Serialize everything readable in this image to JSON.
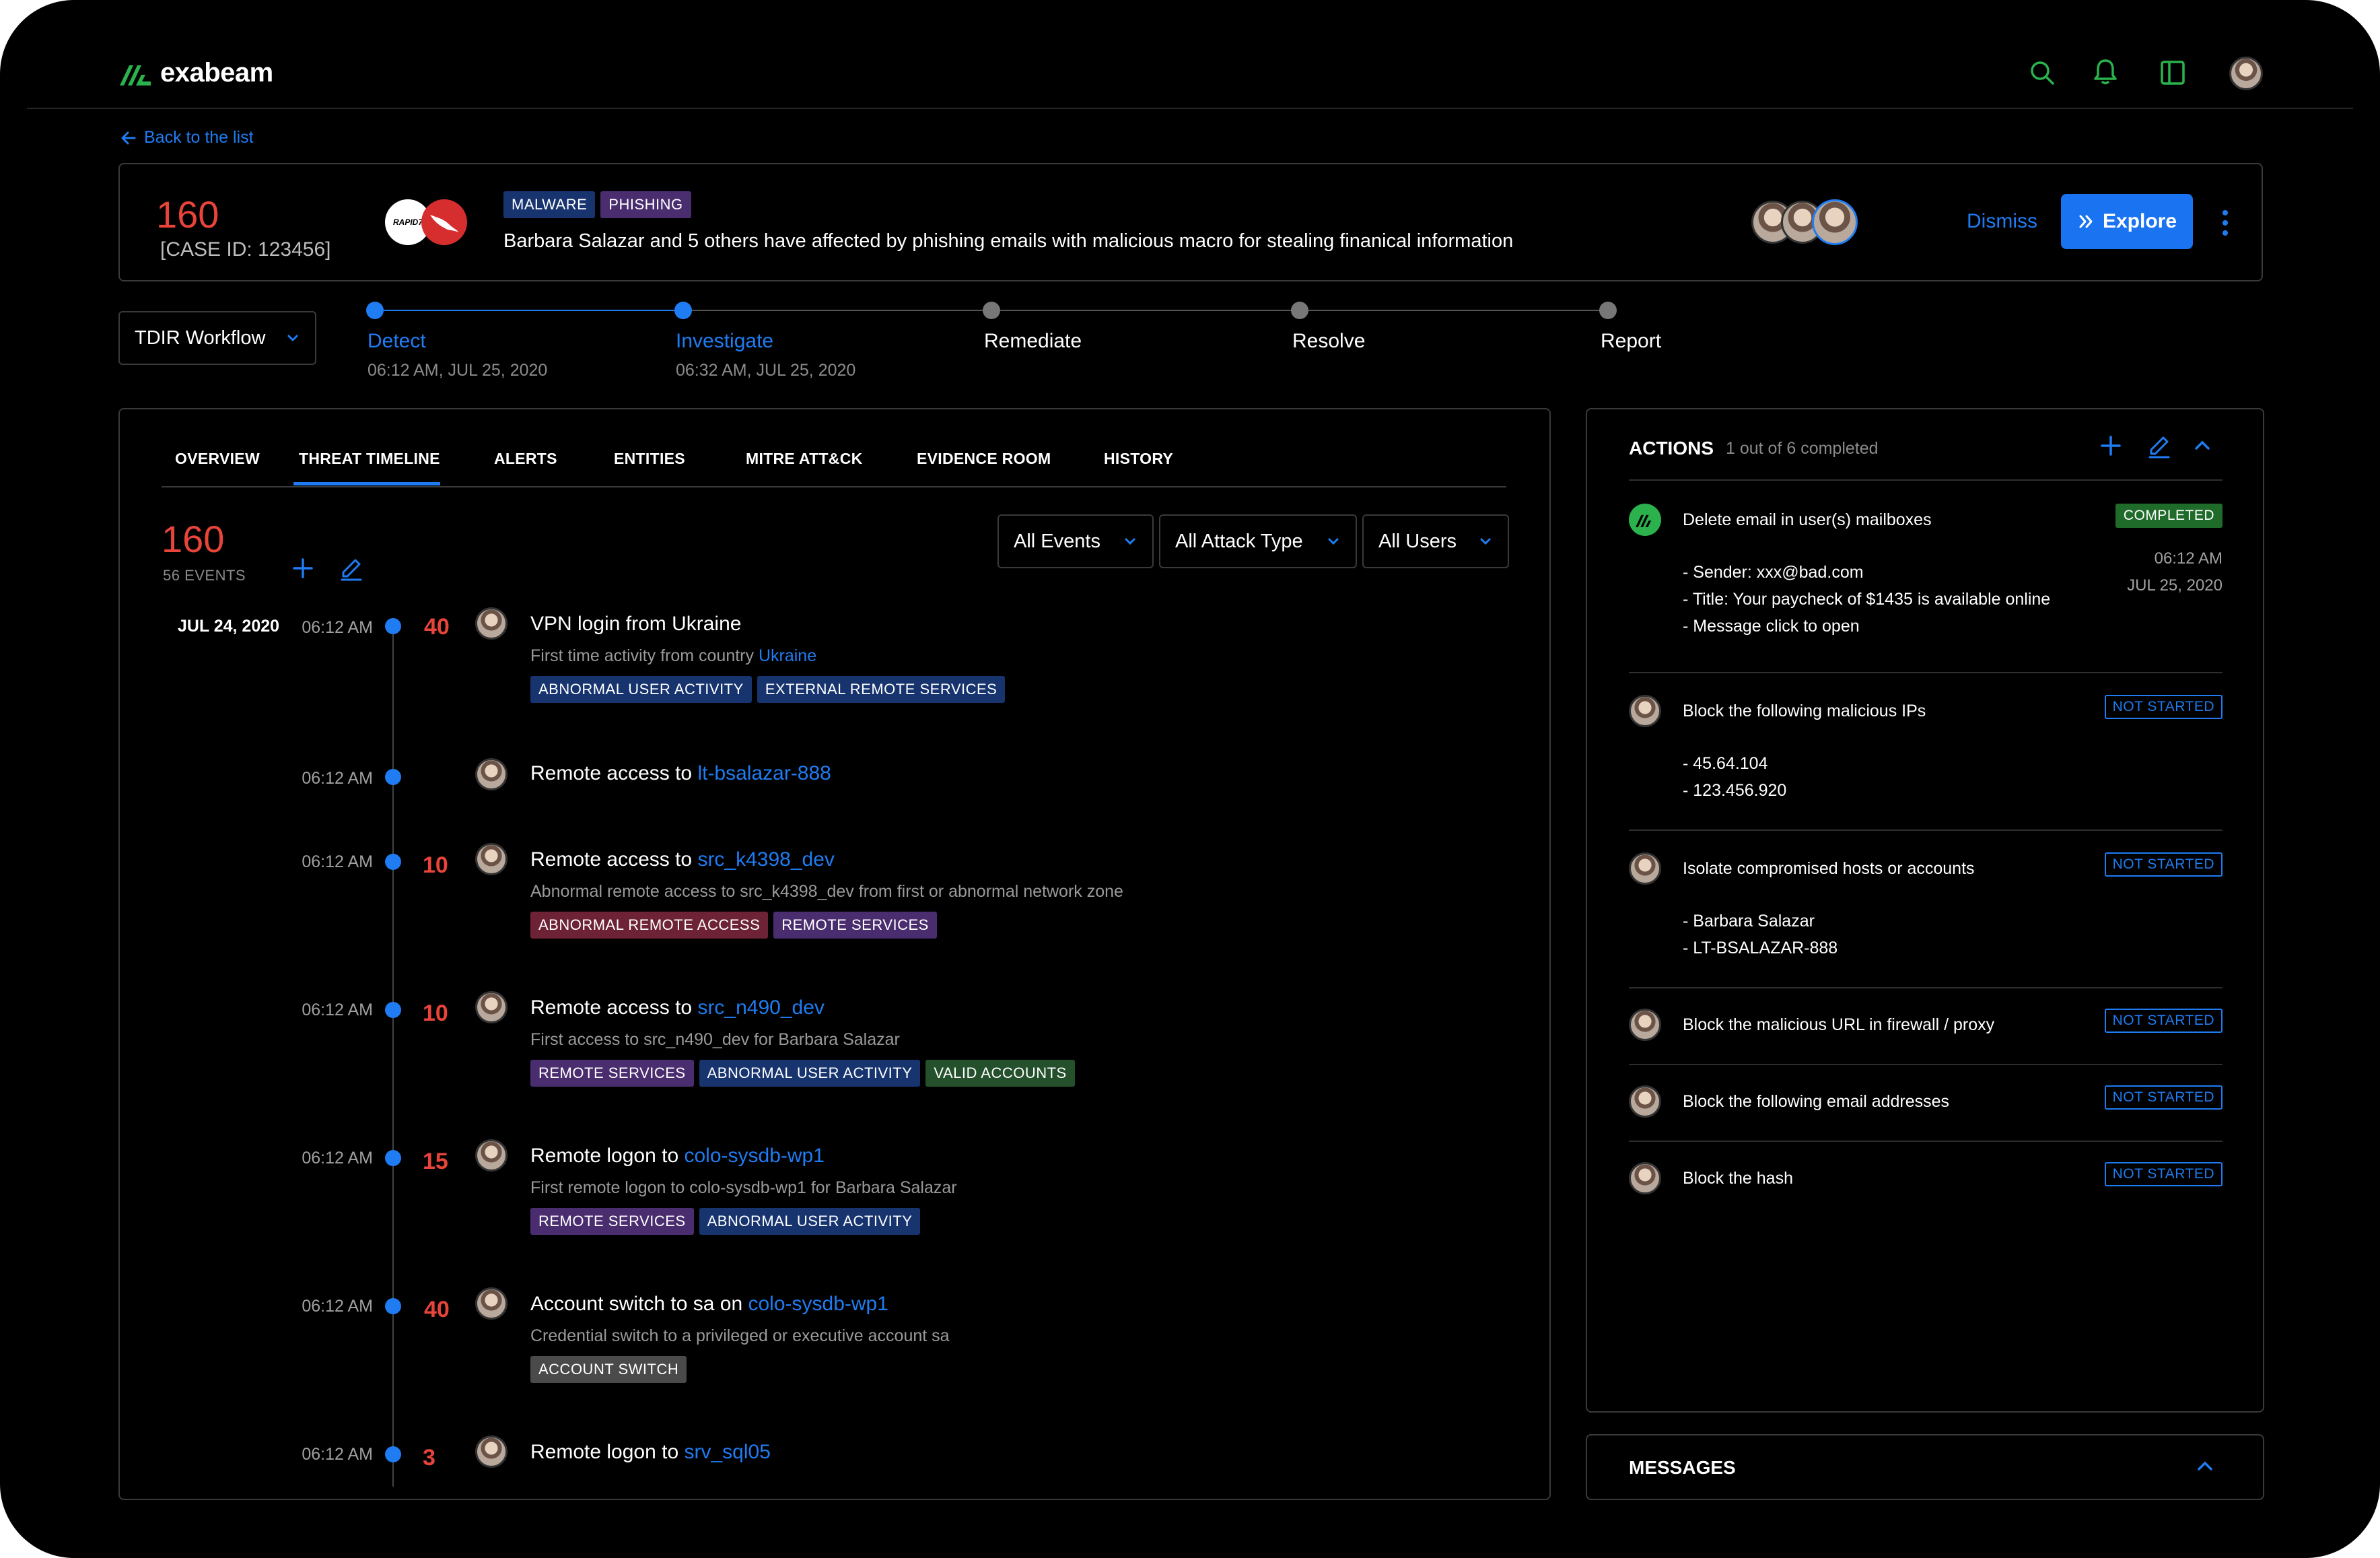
{
  "app": {
    "logo_text": "exabeam",
    "brand_color": "#2bb24c",
    "accent_color": "#1f7cf2"
  },
  "header_icons": [
    "search-icon",
    "bell-icon",
    "panel-icon",
    "user-avatar"
  ],
  "back_link": "Back to the list",
  "case": {
    "score": "160",
    "case_id": "[CASE ID: 123456]",
    "vendor_logo": "RAPID7",
    "tags": [
      "MALWARE",
      "PHISHING"
    ],
    "title": "Barbara Salazar and 5 others have affected by phishing emails with malicious macro for stealing finanical information",
    "dismiss": "Dismiss",
    "explore": "Explore"
  },
  "workflow": {
    "label": "TDIR Workflow"
  },
  "steps": [
    {
      "label": "Detect",
      "time": "06:12 AM, JUL 25, 2020",
      "state": "done"
    },
    {
      "label": "Investigate",
      "time": "06:32 AM, JUL 25, 2020",
      "state": "active"
    },
    {
      "label": "Remediate",
      "time": "",
      "state": "pending"
    },
    {
      "label": "Resolve",
      "time": "",
      "state": "pending"
    },
    {
      "label": "Report",
      "time": "",
      "state": "pending"
    }
  ],
  "tabs": [
    "OVERVIEW",
    "THREAT TIMELINE",
    "ALERTS",
    "ENTITIES",
    "MITRE ATT&CK",
    "EVIDENCE ROOM",
    "HISTORY"
  ],
  "active_tab": "THREAT TIMELINE",
  "timeline": {
    "score": "160",
    "events_count": "56 EVENTS",
    "filters": [
      "All Events",
      "All Attack Type",
      "All Users"
    ],
    "date": "JUL 24, 2020",
    "events": [
      {
        "time": "06:12 AM",
        "score": "40",
        "title": "VPN login from Ukraine",
        "link": "",
        "desc": "First time activity from country ",
        "desc_link": "Ukraine",
        "tags": [
          {
            "t": "ABNORMAL USER ACTIVITY",
            "c": "blue"
          },
          {
            "t": "EXTERNAL REMOTE SERVICES",
            "c": "blue"
          }
        ]
      },
      {
        "time": "06:12 AM",
        "score": "",
        "title": "Remote access to ",
        "link": "lt-bsalazar-888",
        "desc": "",
        "desc_link": "",
        "tags": []
      },
      {
        "time": "06:12 AM",
        "score": "10",
        "title": "Remote access to ",
        "link": "src_k4398_dev",
        "desc": "Abnormal remote access to src_k4398_dev from first or abnormal network zone",
        "desc_link": "",
        "tags": [
          {
            "t": "ABNORMAL REMOTE ACCESS",
            "c": "red"
          },
          {
            "t": "REMOTE SERVICES",
            "c": "purple"
          }
        ]
      },
      {
        "time": "06:12 AM",
        "score": "10",
        "title": "Remote access to ",
        "link": "src_n490_dev",
        "desc": "First access to src_n490_dev for Barbara Salazar",
        "desc_link": "",
        "tags": [
          {
            "t": "REMOTE SERVICES",
            "c": "purple"
          },
          {
            "t": "ABNORMAL USER ACTIVITY",
            "c": "blue"
          },
          {
            "t": "VALID ACCOUNTS",
            "c": "green"
          }
        ]
      },
      {
        "time": "06:12 AM",
        "score": "15",
        "title": "Remote logon to ",
        "link": "colo-sysdb-wp1",
        "desc": "First remote logon to colo-sysdb-wp1 for Barbara Salazar",
        "desc_link": "",
        "tags": [
          {
            "t": "REMOTE SERVICES",
            "c": "purple"
          },
          {
            "t": "ABNORMAL USER ACTIVITY",
            "c": "blue"
          }
        ]
      },
      {
        "time": "06:12 AM",
        "score": "40",
        "title": "Account switch to sa on ",
        "link": "colo-sysdb-wp1",
        "desc": "Credential switch to a privileged or executive account sa",
        "desc_link": "",
        "tags": [
          {
            "t": "ACCOUNT SWITCH",
            "c": "gray"
          }
        ]
      },
      {
        "time": "06:12 AM",
        "score": "3",
        "title": "Remote logon to ",
        "link": "srv_sql05",
        "desc": "",
        "desc_link": "",
        "tags": []
      }
    ]
  },
  "actions": {
    "title": "ACTIONS",
    "progress": "1 out of 6 completed",
    "items": [
      {
        "text": "Delete email in user(s) mailboxes",
        "status": "COMPLETED",
        "time": "06:12 AM",
        "date": "JUL 25, 2020",
        "details": [
          "- Sender: xxx@bad.com",
          "- Title: Your paycheck of $1435 is available online",
          "- Message click to open"
        ]
      },
      {
        "text": "Block the following malicious IPs",
        "status": "NOT STARTED",
        "details": [
          "- 45.64.104",
          "- 123.456.920"
        ]
      },
      {
        "text": "Isolate compromised hosts or accounts",
        "status": "NOT STARTED",
        "details": [
          "- Barbara Salazar",
          "- LT-BSALAZAR-888"
        ]
      },
      {
        "text": "Block the malicious URL in firewall / proxy",
        "status": "NOT STARTED",
        "details": []
      },
      {
        "text": "Block the following email addresses",
        "status": "NOT STARTED",
        "details": []
      },
      {
        "text": "Block the hash",
        "status": "NOT STARTED",
        "details": []
      }
    ]
  },
  "messages": {
    "title": "MESSAGES"
  }
}
